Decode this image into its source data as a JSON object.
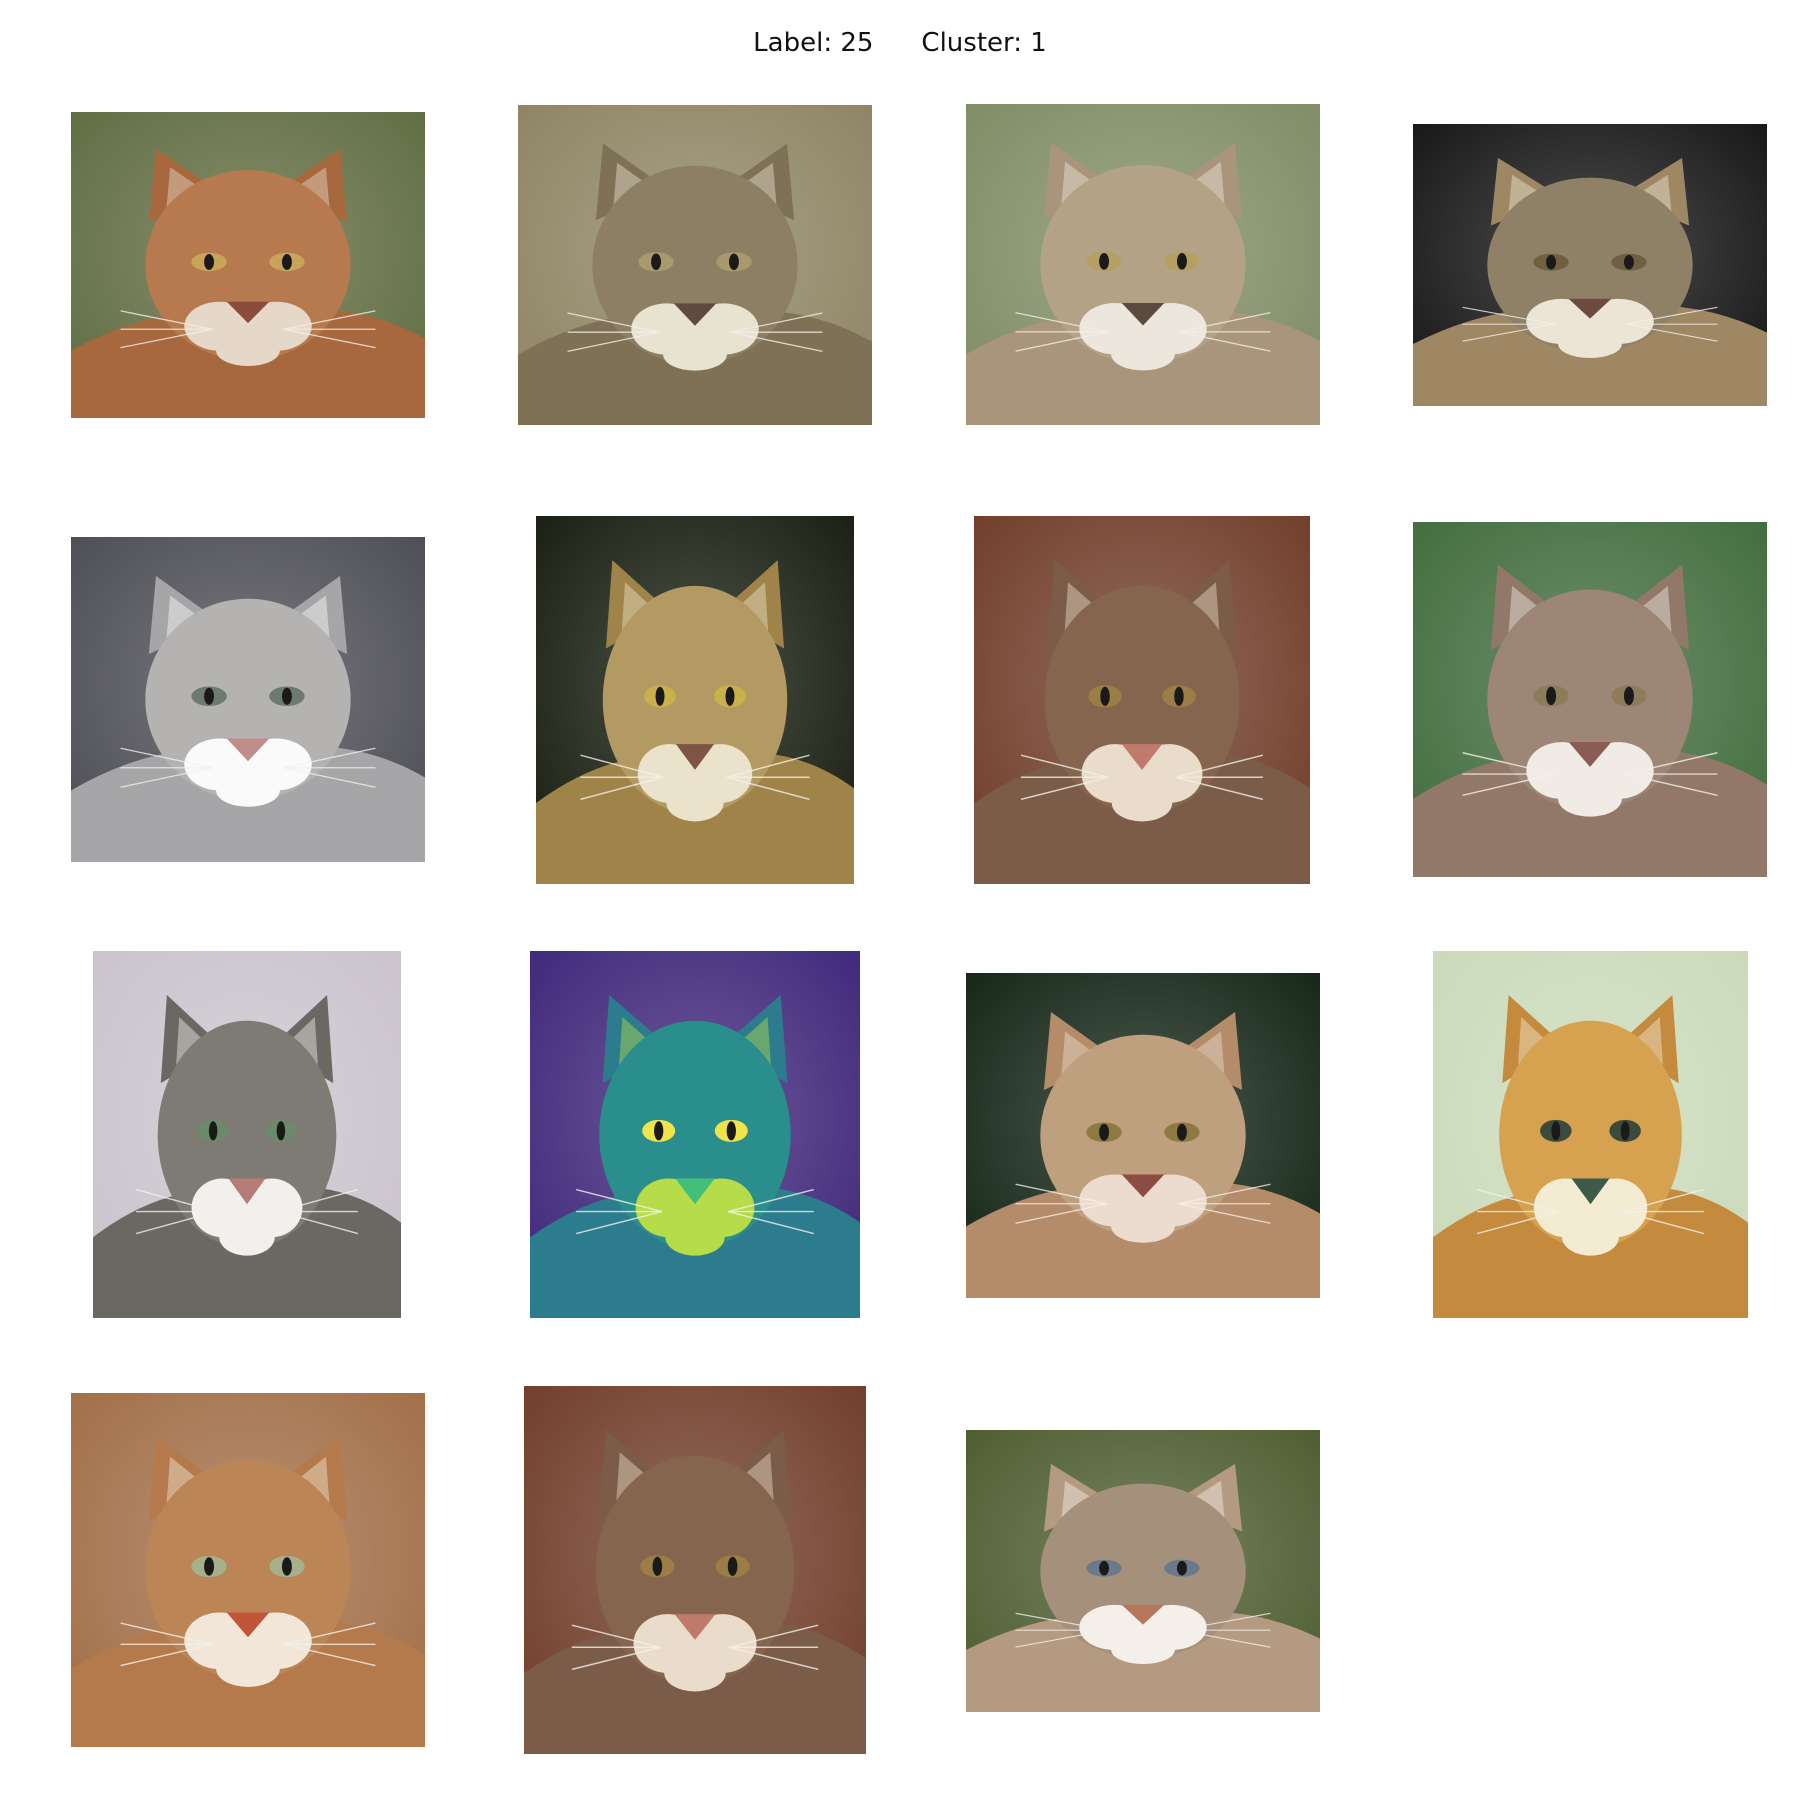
{
  "figure": {
    "label_text": "Label: 25",
    "cluster_text": "Cluster: 1"
  },
  "images": [
    {
      "subject": "cougar",
      "palette": {
        "bg": "#5d6a3e",
        "fur": "#a8683e",
        "face": "#b77a4e",
        "muzzle": "#e6d8c8",
        "nose": "#8c4c3c",
        "eye": "#c8a45a"
      }
    },
    {
      "subject": "cougar",
      "palette": {
        "bg": "#8c8260",
        "fur": "#7f7156",
        "face": "#8d7f63",
        "muzzle": "#e8e2d0",
        "nose": "#5e4a40",
        "eye": "#a89a6c"
      }
    },
    {
      "subject": "cougar",
      "palette": {
        "bg": "#7d8a62",
        "fur": "#a8957c",
        "face": "#b4a287",
        "muzzle": "#ece6dc",
        "nose": "#5b4a40",
        "eye": "#b4a060"
      }
    },
    {
      "subject": "cougar",
      "palette": {
        "bg": "#121212",
        "fur": "#9e8762",
        "face": "#8f8068",
        "muzzle": "#ece4d4",
        "nose": "#6c4a3e",
        "eye": "#6e6040"
      }
    },
    {
      "subject": "cougar",
      "palette": {
        "bg": "#4a4b52",
        "fur": "#a6a6a8",
        "face": "#b4b3b2",
        "muzzle": "#fafafa",
        "nose": "#c08e8a",
        "eye": "#6c7a70"
      }
    },
    {
      "subject": "cougar",
      "palette": {
        "bg": "#141a0c",
        "fur": "#a08348",
        "face": "#b39a62",
        "muzzle": "#ebe2cc",
        "nose": "#7e5444",
        "eye": "#c8b04a"
      }
    },
    {
      "subject": "cougar",
      "palette": {
        "bg": "#6e3a26",
        "fur": "#7b5c48",
        "face": "#86654e",
        "muzzle": "#eadcca",
        "nose": "#c07a6c",
        "eye": "#9a7e46"
      }
    },
    {
      "subject": "cougar",
      "palette": {
        "bg": "#3e6a3a",
        "fur": "#917868",
        "face": "#9d8676",
        "muzzle": "#f0ebe4",
        "nose": "#8a5c54",
        "eye": "#8c7c5a"
      }
    },
    {
      "subject": "cougar",
      "palette": {
        "bg": "#c9c2cc",
        "fur": "#6a6862",
        "face": "#7d7b74",
        "muzzle": "#f2f0ec",
        "nose": "#b77c78",
        "eye": "#6c8a6a"
      }
    },
    {
      "subject": "cougar",
      "palette": {
        "bg": "#3c2378",
        "fur": "#2d7c8e",
        "face": "#2a8f8c",
        "muzzle": "#b6dc4a",
        "nose": "#42bf78",
        "eye": "#f0e44a"
      }
    },
    {
      "subject": "cougar",
      "palette": {
        "bg": "#102212",
        "fur": "#b48c6a",
        "face": "#bfa07e",
        "muzzle": "#ecdcd0",
        "nose": "#8c4c44",
        "eye": "#8c7a40"
      }
    },
    {
      "subject": "cougar painting",
      "palette": {
        "bg": "#c9d9b8",
        "fur": "#c48a3e",
        "face": "#d6a250",
        "muzzle": "#f3ecd2",
        "nose": "#3e5a48",
        "eye": "#3b4a3a"
      }
    },
    {
      "subject": "cougar",
      "palette": {
        "bg": "#a06c44",
        "fur": "#b47a4c",
        "face": "#bb8556",
        "muzzle": "#f2e6d8",
        "nose": "#c2543a",
        "eye": "#a6b08a"
      }
    },
    {
      "subject": "cougar",
      "palette": {
        "bg": "#6e3a26",
        "fur": "#7b5c48",
        "face": "#86654e",
        "muzzle": "#eadcca",
        "nose": "#c07a6c",
        "eye": "#9a7e46"
      }
    },
    {
      "subject": "cougar",
      "palette": {
        "bg": "#4a5a2c",
        "fur": "#b49a80",
        "face": "#a5907c",
        "muzzle": "#f4efe8",
        "nose": "#b7765c",
        "eye": "#6a7a8a"
      }
    }
  ]
}
